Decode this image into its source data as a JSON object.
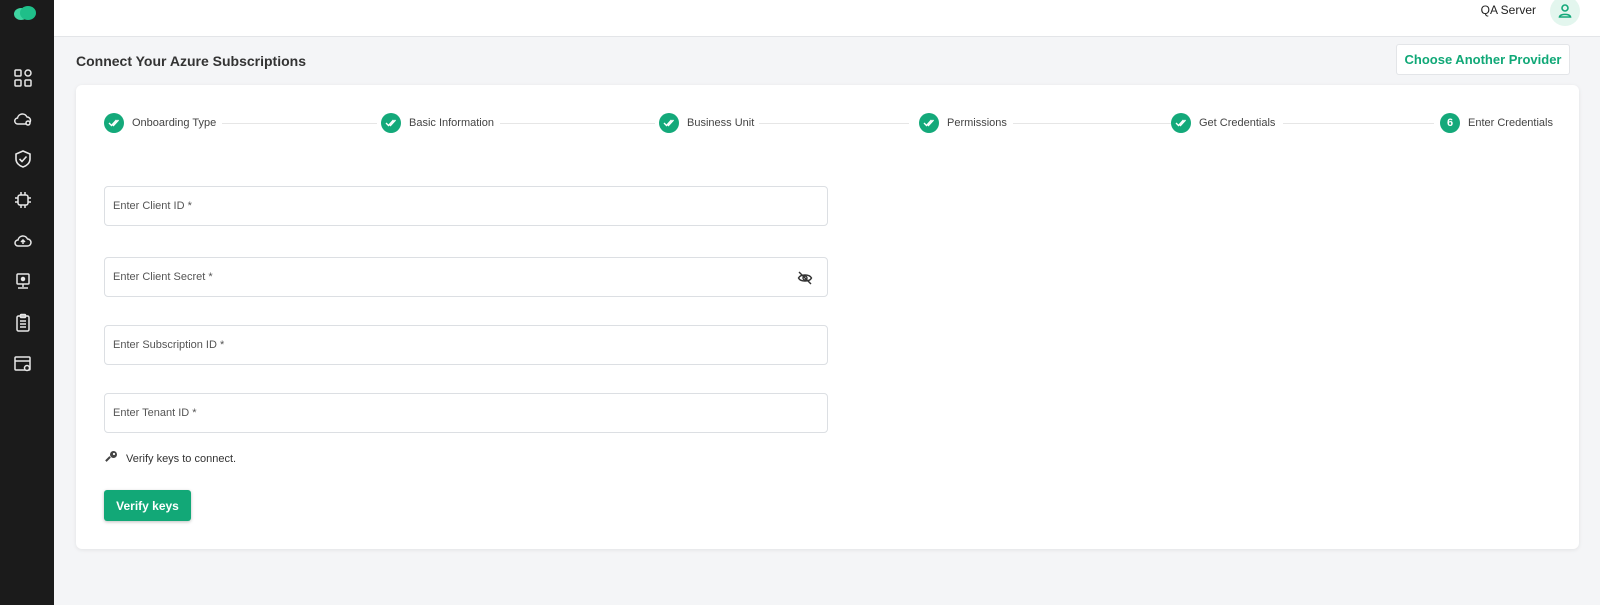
{
  "topbar": {
    "server_label": "QA Server"
  },
  "sidebar": {
    "icons": [
      "dashboard-icon",
      "cloud-settings-icon",
      "shield-check-icon",
      "chip-icon",
      "cloud-upload-icon",
      "monitor-person-icon",
      "clipboard-icon",
      "window-settings-icon"
    ]
  },
  "header": {
    "title": "Connect Your Azure Subscriptions",
    "choose_provider_label": "Choose Another Provider"
  },
  "stepper": {
    "steps": [
      {
        "label": "Onboarding Type",
        "status": "done"
      },
      {
        "label": "Basic Information",
        "status": "done"
      },
      {
        "label": "Business Unit",
        "status": "done"
      },
      {
        "label": "Permissions",
        "status": "done"
      },
      {
        "label": "Get Credentials",
        "status": "done"
      },
      {
        "label": "Enter Credentials",
        "status": "active",
        "number": "6"
      }
    ]
  },
  "form": {
    "client_id": {
      "placeholder": "Enter Client ID *",
      "value": ""
    },
    "client_secret": {
      "placeholder": "Enter Client Secret *",
      "value": ""
    },
    "subscription_id": {
      "placeholder": "Enter Subscription ID *",
      "value": ""
    },
    "tenant_id": {
      "placeholder": "Enter Tenant ID *",
      "value": ""
    },
    "hint": "Verify keys to connect.",
    "verify_label": "Verify keys"
  },
  "colors": {
    "accent": "#12a877",
    "sidebar_bg": "#1b1b1b"
  }
}
